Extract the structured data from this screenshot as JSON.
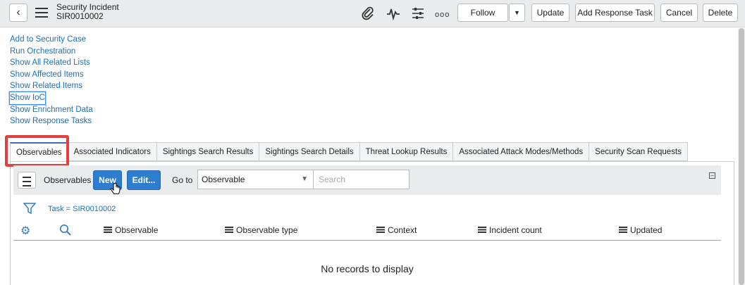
{
  "header": {
    "title": "Security Incident",
    "number": "SIR0010002",
    "buttons": {
      "follow": "Follow",
      "update": "Update",
      "add_response_task": "Add Response Task",
      "cancel": "Cancel",
      "delete": "Delete"
    },
    "icons": [
      "paperclip-icon",
      "activity-icon",
      "settings-sliders-icon",
      "more-icon"
    ]
  },
  "related_links": [
    "Add to Security Case",
    "Run Orchestration",
    "Show All Related Lists",
    "Show Affected Items",
    "Show Related Items",
    "Show IoC",
    "Show Enrichment Data",
    "Show Response Tasks"
  ],
  "tabs": [
    "Observables",
    "Associated Indicators",
    "Sightings Search Results",
    "Sightings Search Details",
    "Threat Lookup Results",
    "Associated Attack Modes/Methods",
    "Security Scan Requests"
  ],
  "list": {
    "title": "Observables",
    "new_label": "New",
    "edit_label": "Edit...",
    "goto_label": "Go to",
    "goto_selected": "Observable",
    "search_placeholder": "Search",
    "filter": "Task = SIR0010002",
    "columns": [
      "Observable",
      "Observable type",
      "Context",
      "Incident count",
      "Updated"
    ],
    "empty_message": "No records to display"
  },
  "colors": {
    "link": "#1f6fb5",
    "primary_button": "#2f7dcf",
    "highlight_box": "#e2403e"
  }
}
